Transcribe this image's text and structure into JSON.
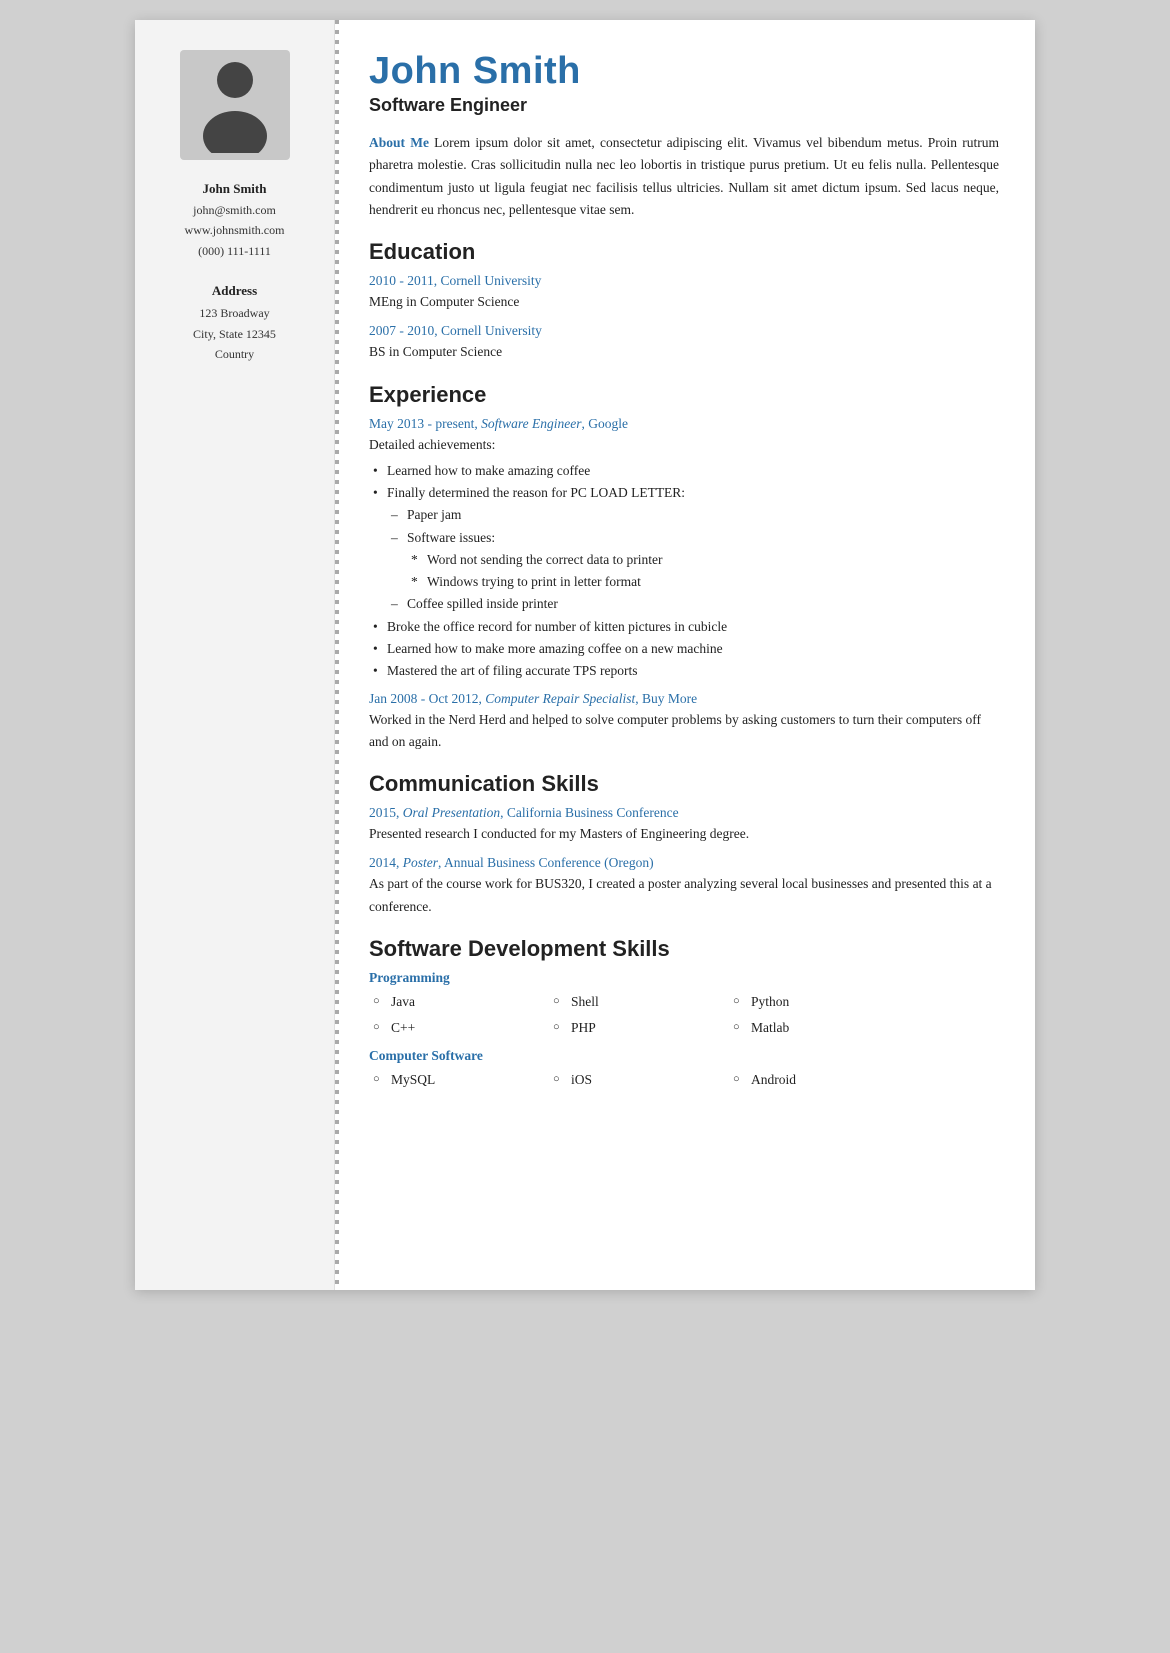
{
  "sidebar": {
    "name": "John Smith",
    "email": "john@smith.com",
    "website": "www.johnsmith.com",
    "phone": "(000) 111-1111",
    "address_label": "Address",
    "address_line1": "123 Broadway",
    "address_line2": "City, State 12345",
    "address_line3": "Country"
  },
  "header": {
    "name": "John Smith",
    "title": "Software Engineer"
  },
  "about_me": {
    "label": "About Me",
    "text": " Lorem ipsum dolor sit amet, consectetur adipiscing elit. Vivamus vel bibendum metus. Proin rutrum pharetra molestie. Cras sollicitudin nulla nec leo lobortis in tristique purus pretium. Ut eu felis nulla. Pellentesque condimentum justo ut ligula feugiat nec facilisis tellus ultricies. Nullam sit amet dictum ipsum. Sed lacus neque, hendrerit eu rhoncus nec, pellentesque vitae sem."
  },
  "education": {
    "section_title": "Education",
    "entries": [
      {
        "header": "2010 - 2011, Cornell University",
        "body": "MEng in Computer Science"
      },
      {
        "header": "2007 - 2010, Cornell University",
        "body": "BS in Computer Science"
      }
    ]
  },
  "experience": {
    "section_title": "Experience",
    "entries": [
      {
        "header": "May 2013 - present, Software Engineer, Google",
        "header_italic": "Software Engineer",
        "intro": "Detailed achievements:",
        "bullets": [
          "Learned how to make amazing coffee",
          "Finally determined the reason for PC LOAD LETTER:",
          "Broke the office record for number of kitten pictures in cubicle",
          "Learned how to make more amazing coffee on a new machine",
          "Mastered the art of filing accurate TPS reports"
        ],
        "sub_bullets": [
          "Paper jam",
          "Software issues:"
        ],
        "sub_sub_bullets": [
          "Word not sending the correct data to printer",
          "Windows trying to print in letter format"
        ],
        "sub_bullet3": "Coffee spilled inside printer"
      },
      {
        "header": "Jan 2008 - Oct 2012, Computer Repair Specialist, Buy More",
        "header_italic": "Computer Repair Specialist",
        "body": "Worked in the Nerd Herd and helped to solve computer problems by asking customers to turn their computers off and on again."
      }
    ]
  },
  "communication_skills": {
    "section_title": "Communication Skills",
    "entries": [
      {
        "header": "2015, Oral Presentation, California Business Conference",
        "header_italic": "Oral Presentation",
        "body": "Presented research I conducted for my Masters of Engineering degree."
      },
      {
        "header": "2014, Poster, Annual Business Conference (Oregon)",
        "header_italic": "Poster",
        "body": "As part of the course work for BUS320, I created a poster analyzing several local businesses and presented this at a conference."
      }
    ]
  },
  "software_skills": {
    "section_title": "Software Development Skills",
    "categories": [
      {
        "label": "Programming",
        "items": [
          "Java",
          "C++",
          "Shell",
          "PHP",
          "Python",
          "Matlab"
        ]
      },
      {
        "label": "Computer Software",
        "items": [
          "MySQL",
          "iOS",
          "Android"
        ]
      }
    ]
  }
}
